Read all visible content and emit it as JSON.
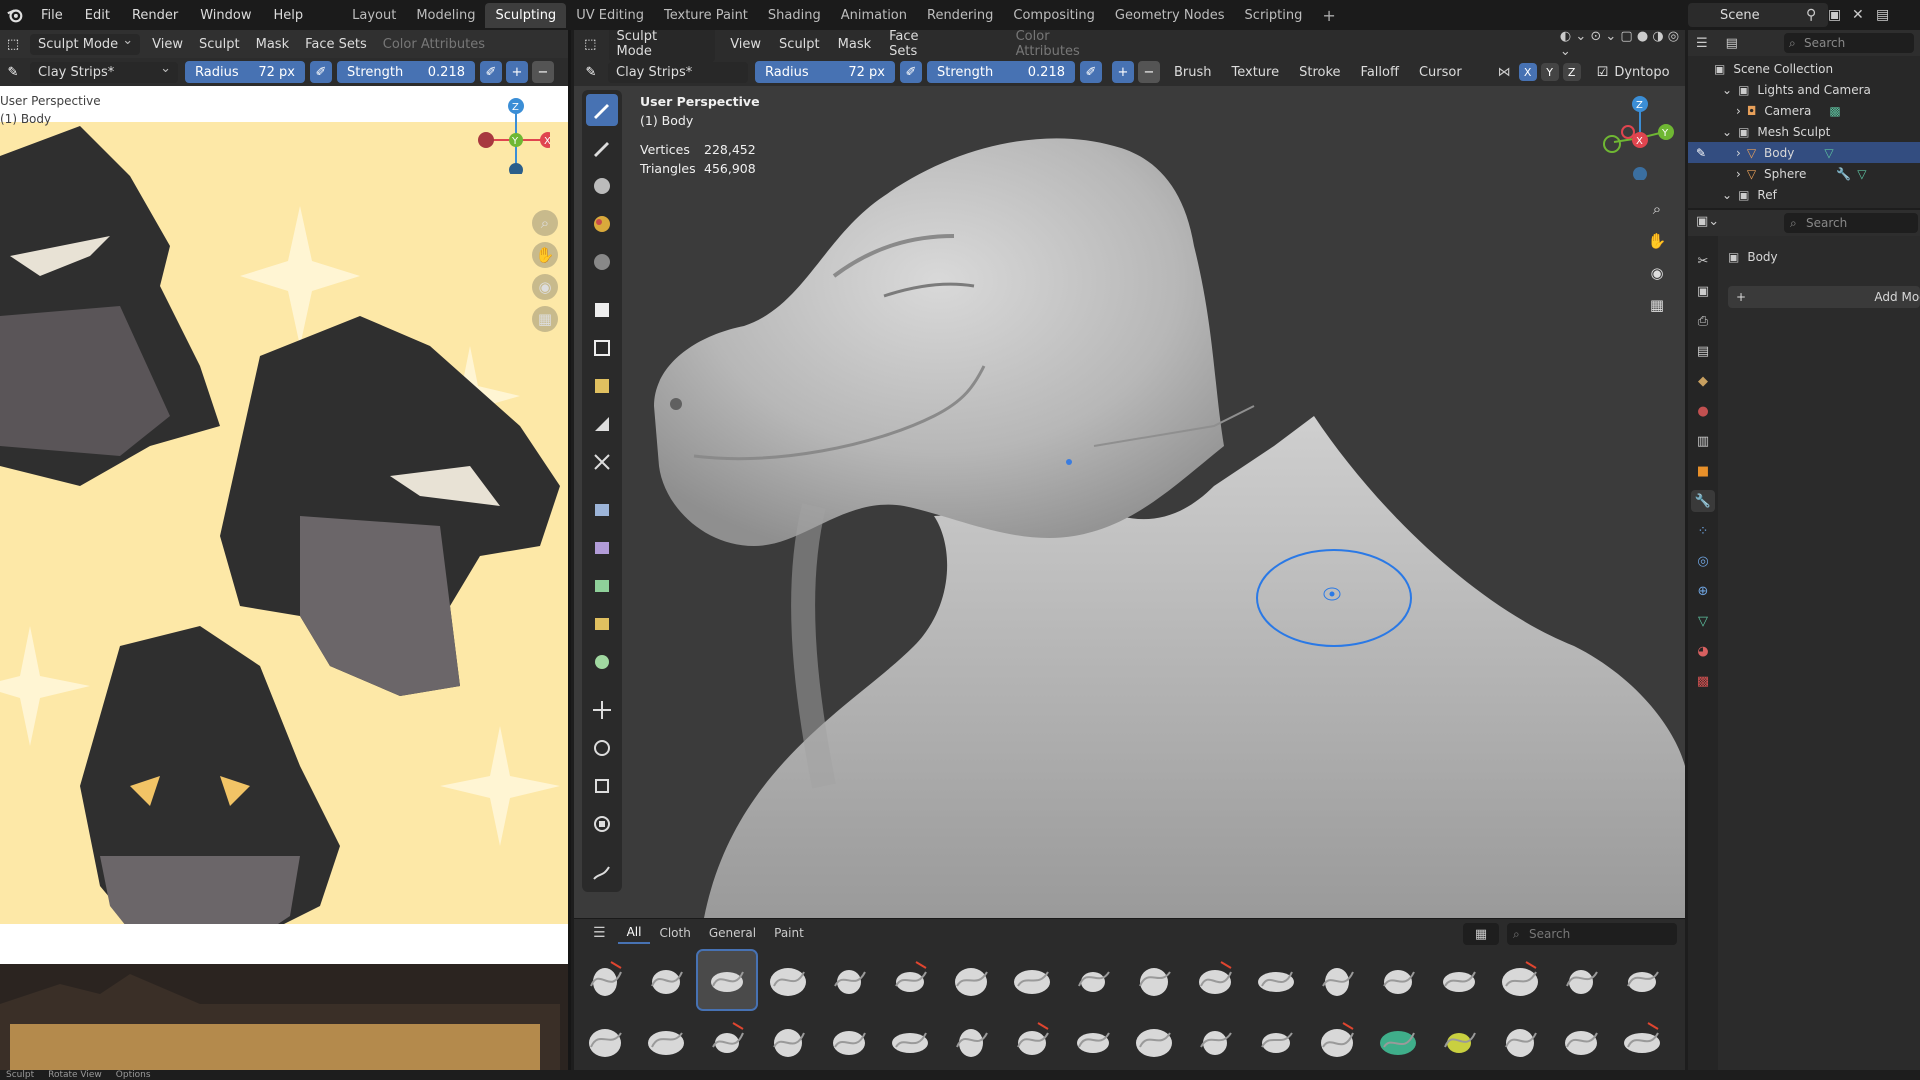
{
  "topbar": {
    "menus": [
      "File",
      "Edit",
      "Render",
      "Window",
      "Help"
    ],
    "workspaces": [
      "Layout",
      "Modeling",
      "Sculpting",
      "UV Editing",
      "Texture Paint",
      "Shading",
      "Animation",
      "Rendering",
      "Compositing",
      "Geometry Nodes",
      "Scripting"
    ],
    "active_workspace": "Sculpting",
    "add_workspace": "+",
    "scene_name": "Scene"
  },
  "left_editor": {
    "mode": "Sculpt Mode",
    "menus": [
      "View",
      "Sculpt",
      "Mask",
      "Face Sets"
    ],
    "color_attributes": "Color Attributes",
    "brush": "Clay Strips*",
    "radius_label": "Radius",
    "radius_value": "72 px",
    "strength_label": "Strength",
    "strength_value": "0.218",
    "perspective": "User Perspective",
    "object": "(1) Body"
  },
  "viewport": {
    "mode": "Sculpt Mode",
    "menus": [
      "View",
      "Sculpt",
      "Mask",
      "Face Sets"
    ],
    "color_attributes": "Color Attributes",
    "brush": "Clay Strips*",
    "radius_label": "Radius",
    "radius_value": "72 px",
    "strength_label": "Strength",
    "strength_value": "0.218",
    "dropdowns": [
      "Brush",
      "Texture",
      "Stroke",
      "Falloff",
      "Cursor"
    ],
    "axes": [
      "X",
      "Y",
      "Z"
    ],
    "dyntopo": "Dyntopo",
    "perspective": "User Perspective",
    "object": "(1) Body",
    "vertices_label": "Vertices",
    "vertices_value": "228,452",
    "triangles_label": "Triangles",
    "triangles_value": "456,908"
  },
  "asset_shelf": {
    "tabs": [
      "All",
      "Cloth",
      "General",
      "Paint"
    ],
    "active_tab": "All",
    "search_placeholder": "Search"
  },
  "outliner": {
    "search_placeholder": "Search",
    "rows": [
      "Scene Collection",
      "Lights and Camera",
      "Camera",
      "Mesh Sculpt",
      "Body",
      "Sphere",
      "Ref"
    ],
    "selected": "Body"
  },
  "properties": {
    "search_placeholder": "Search",
    "object_name": "Body",
    "add_modifier": "Add Modifier"
  },
  "statusbar": {
    "items": [
      "Sculpt",
      "Rotate View",
      "Options"
    ]
  },
  "colors": {
    "accent": "#4772b3",
    "ref_background": "#fde8a7",
    "x_axis": "#e0454f",
    "y_axis": "#6fb733",
    "z_axis": "#3b8ed6"
  }
}
